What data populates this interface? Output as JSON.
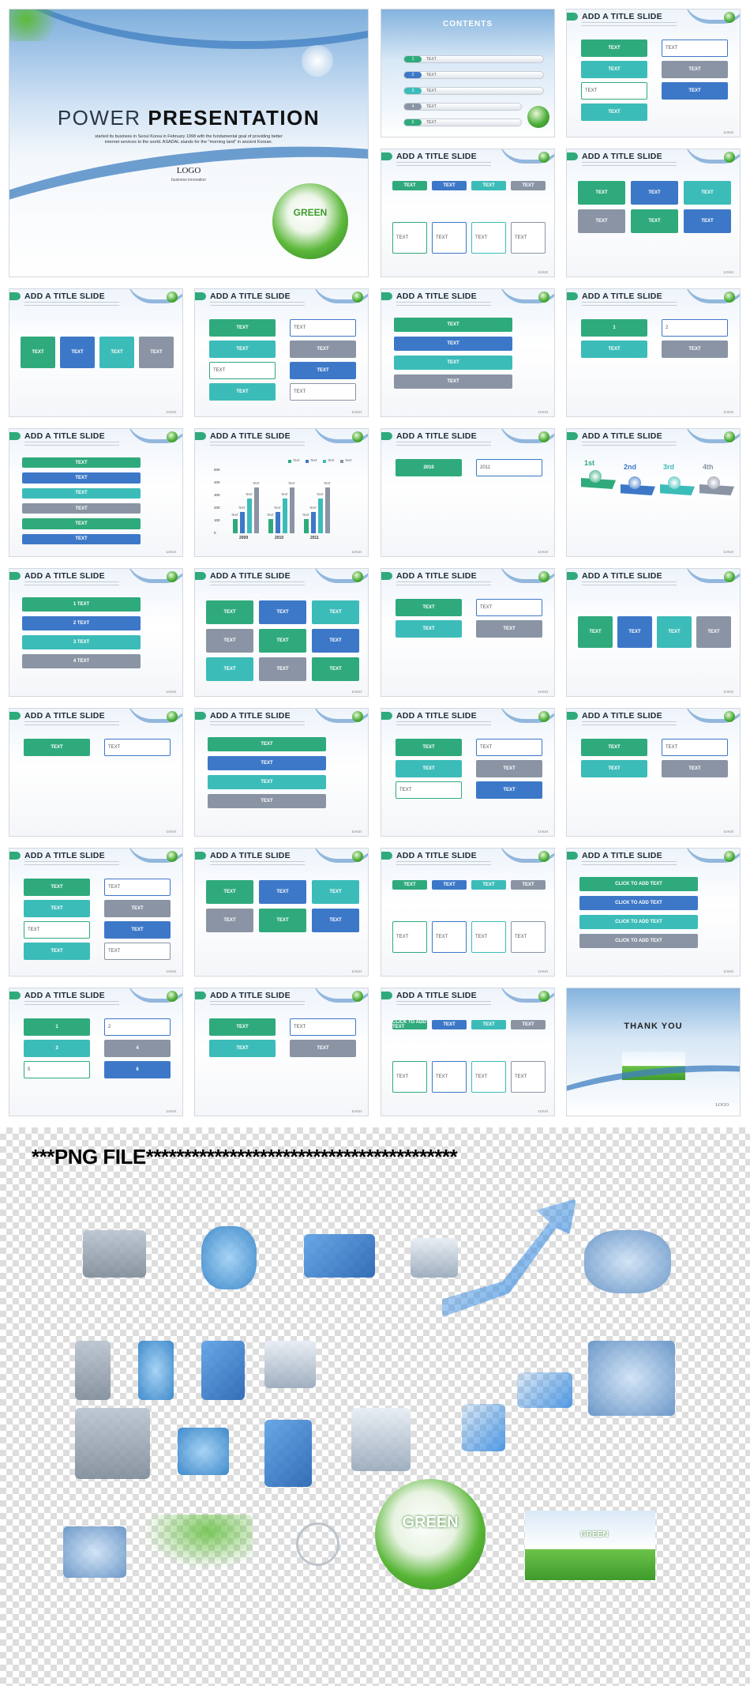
{
  "colors": {
    "green": "#2faa7c",
    "blue": "#3d78c8",
    "teal": "#3cbcb8",
    "gray": "#8a94a4",
    "orange": "#f59a3c"
  },
  "title_slide": {
    "title_a": "POWER",
    "title_b": "PRESENTATION",
    "subtitle_1": "started its business in Seoul Korea in February 1998 with the fundamental  goal of providing better",
    "subtitle_2": "internet services to the world. ASADAL stands for the \"morning land\" in ancient Korean.",
    "logo": "LOGO",
    "tagline": "business innovation",
    "globe_label": "GREEN"
  },
  "footer_logo": "LOGO",
  "slides": [
    {
      "type": "contents",
      "title": "CONTENTS",
      "labels": [
        "1",
        "TEXT",
        "2",
        "TEXT",
        "3",
        "TEXT",
        "4",
        "TEXT",
        "5",
        "TEXT"
      ]
    },
    {
      "type": "grid2",
      "title": "ADD A TITLE SLIDE",
      "labels": [
        "TEXT",
        "TEXT",
        "TEXT",
        "TEXT",
        "TEXT",
        "TEXT",
        "TEXT"
      ]
    },
    {
      "type": "cols4",
      "title": "ADD A TITLE SLIDE",
      "labels": [
        "TEXT",
        "TEXT",
        "TEXT",
        "TEXT",
        "TEXT",
        "TEXT",
        "TEXT",
        "TEXT"
      ]
    },
    {
      "type": "grid3",
      "title": "ADD A TITLE SLIDE",
      "labels": [
        "TEXT",
        "TEXT",
        "TEXT",
        "TEXT",
        "TEXT",
        "TEXT"
      ]
    },
    {
      "type": "cols4",
      "title": "ADD A TITLE SLIDE",
      "labels": [
        "TEXT",
        "TEXT",
        "TEXT",
        "TEXT"
      ]
    },
    {
      "type": "grid2",
      "title": "ADD A TITLE SLIDE",
      "labels": [
        "TEXT",
        "TEXT",
        "TEXT",
        "TEXT",
        "TEXT",
        "TEXT",
        "TEXT",
        "TEXT"
      ]
    },
    {
      "type": "list",
      "title": "ADD A TITLE SLIDE",
      "labels": [
        "TEXT",
        "TEXT",
        "TEXT",
        "TEXT"
      ]
    },
    {
      "type": "grid2",
      "title": "ADD A TITLE SLIDE",
      "labels": [
        "1",
        "2",
        "TEXT",
        "TEXT"
      ]
    },
    {
      "type": "list",
      "title": "ADD A TITLE SLIDE",
      "labels": [
        "TEXT",
        "TEXT",
        "TEXT",
        "TEXT",
        "TEXT",
        "TEXT"
      ]
    },
    {
      "type": "chart",
      "title": "ADD A TITLE SLIDE",
      "labels": []
    },
    {
      "type": "grid2",
      "title": "ADD A TITLE SLIDE",
      "labels": [
        "2010",
        "2011"
      ]
    },
    {
      "type": "ranks",
      "title": "ADD A TITLE SLIDE",
      "labels": [
        "1st",
        "2nd",
        "3rd",
        "4th"
      ]
    },
    {
      "type": "list",
      "title": "ADD A TITLE SLIDE",
      "labels": [
        "1  TEXT",
        "2  TEXT",
        "3  TEXT",
        "4  TEXT"
      ]
    },
    {
      "type": "grid3",
      "title": "ADD A TITLE SLIDE",
      "labels": [
        "TEXT",
        "TEXT",
        "TEXT",
        "TEXT",
        "TEXT",
        "TEXT",
        "TEXT",
        "TEXT",
        "TEXT"
      ]
    },
    {
      "type": "grid2",
      "title": "ADD A TITLE SLIDE",
      "labels": [
        "TEXT",
        "TEXT",
        "TEXT",
        "TEXT"
      ]
    },
    {
      "type": "cols4",
      "title": "ADD A TITLE SLIDE",
      "labels": [
        "TEXT",
        "TEXT",
        "TEXT",
        "TEXT"
      ]
    },
    {
      "type": "grid2",
      "title": "ADD A TITLE SLIDE",
      "labels": [
        "TEXT",
        "TEXT"
      ]
    },
    {
      "type": "list",
      "title": "ADD A TITLE SLIDE",
      "labels": [
        "TEXT",
        "TEXT",
        "TEXT",
        "TEXT"
      ]
    },
    {
      "type": "grid2",
      "title": "ADD A TITLE SLIDE",
      "labels": [
        "TEXT",
        "TEXT",
        "TEXT",
        "TEXT",
        "TEXT",
        "TEXT"
      ]
    },
    {
      "type": "grid2",
      "title": "ADD A TITLE SLIDE",
      "labels": [
        "TEXT",
        "TEXT",
        "TEXT",
        "TEXT"
      ]
    },
    {
      "type": "grid2",
      "title": "ADD A TITLE SLIDE",
      "labels": [
        "TEXT",
        "TEXT",
        "TEXT",
        "TEXT",
        "TEXT",
        "TEXT",
        "TEXT",
        "TEXT"
      ]
    },
    {
      "type": "grid3",
      "title": "ADD A TITLE SLIDE",
      "labels": [
        "TEXT",
        "TEXT",
        "TEXT",
        "TEXT",
        "TEXT",
        "TEXT"
      ]
    },
    {
      "type": "cols4",
      "title": "ADD A TITLE SLIDE",
      "labels": [
        "TEXT",
        "TEXT",
        "TEXT",
        "TEXT",
        "TEXT",
        "TEXT",
        "TEXT",
        "TEXT"
      ]
    },
    {
      "type": "list",
      "title": "ADD A TITLE SLIDE",
      "labels": [
        "CLICK TO ADD TEXT",
        "CLICK TO ADD TEXT",
        "CLICK TO ADD TEXT",
        "CLICK TO ADD TEXT"
      ]
    },
    {
      "type": "grid2",
      "title": "ADD A TITLE SLIDE",
      "labels": [
        "1",
        "2",
        "3",
        "4",
        "5",
        "6"
      ]
    },
    {
      "type": "grid2",
      "title": "ADD A TITLE SLIDE",
      "labels": [
        "TEXT",
        "TEXT",
        "TEXT",
        "TEXT"
      ]
    },
    {
      "type": "cols4",
      "title": "ADD A TITLE SLIDE",
      "labels": [
        "CLICK TO ADD TEXT",
        "TEXT",
        "TEXT",
        "TEXT",
        "TEXT",
        "TEXT",
        "TEXT",
        "TEXT"
      ]
    },
    {
      "type": "thanks",
      "title": "THANK YOU",
      "labels": []
    }
  ],
  "chart_data": {
    "type": "bar",
    "categories": [
      "2009",
      "2010",
      "2011"
    ],
    "series": [
      {
        "name": "TEXT",
        "values": [
          110,
          170,
          275
        ]
      },
      {
        "name": "TEXT",
        "values": [
          110,
          170,
          275
        ]
      },
      {
        "name": "TEXT",
        "values": [
          110,
          170,
          275
        ]
      },
      {
        "name": "TEXT",
        "values": [
          110,
          170,
          275
        ]
      }
    ],
    "series_values_by_year": [
      [
        110,
        170,
        275,
        365
      ],
      [
        110,
        170,
        275,
        365
      ],
      [
        110,
        170,
        275,
        365
      ]
    ],
    "data_label": "TEXT",
    "yticks": [
      0,
      100,
      200,
      300,
      400,
      500
    ],
    "ylim": [
      0,
      500
    ],
    "legend": "top-right",
    "colors": [
      "#2faa7c",
      "#3d78c8",
      "#3cbcb8",
      "#8a94a4"
    ]
  },
  "png_section": {
    "title": "***PNG FILE*****************************************",
    "globe_label": "GREEN",
    "mini_globe_label": "GREEN",
    "icons": [
      "laptop-icon",
      "globe-stand-icon",
      "refresh-arrows-icon",
      "mouse-click-icon",
      "rising-arrow-icon",
      "handshake-people-icon",
      "building-icon",
      "building-icon",
      "building-icon",
      "building-icon",
      "server-plus-icon",
      "presenter-chart-icon",
      "megaphone-person-icon",
      "monitor-icon",
      "id-card-icon",
      "bar-growth-icon",
      "sync-monitor-icon",
      "tv-icon",
      "leaves-icon",
      "magnifier-icon",
      "green-globe-icon",
      "eco-landscape-icon"
    ]
  }
}
